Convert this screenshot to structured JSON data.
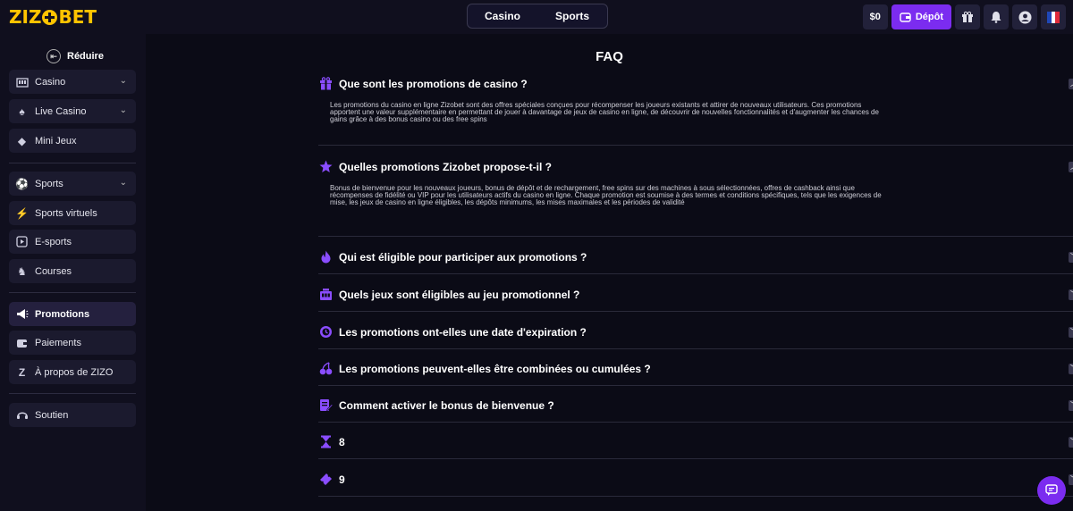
{
  "brand": {
    "part1": "ZIZ",
    "part2": "BET"
  },
  "topnav": [
    "Casino",
    "Sports"
  ],
  "header": {
    "balance": "$0",
    "deposit": "Dépôt"
  },
  "sidebar": {
    "reduce": "Réduire",
    "items": [
      {
        "label": "Casino",
        "icon": "slot-machine-icon",
        "chevron": true
      },
      {
        "label": "Live Casino",
        "icon": "live-casino-icon",
        "chevron": true
      },
      {
        "label": "Mini Jeux",
        "icon": "diamond-icon",
        "chevron": false
      },
      {
        "label": "Sports",
        "icon": "football-icon",
        "chevron": true
      },
      {
        "label": "Sports virtuels",
        "icon": "virtual-sports-icon",
        "chevron": false
      },
      {
        "label": "E-sports",
        "icon": "gamepad-icon",
        "chevron": false
      },
      {
        "label": "Courses",
        "icon": "horse-icon",
        "chevron": false
      },
      {
        "label": "Promotions",
        "icon": "megaphone-icon",
        "chevron": false
      },
      {
        "label": "Paiements",
        "icon": "wallet-icon",
        "chevron": false
      },
      {
        "label": "À propos de ZIZO",
        "icon": "zizo-z-icon",
        "chevron": false
      },
      {
        "label": "Soutien",
        "icon": "support-icon",
        "chevron": false
      }
    ]
  },
  "faq": {
    "title": "FAQ",
    "items": [
      {
        "q": "Que sont les promotions de casino ?",
        "icon": "gift-icon",
        "open": true,
        "a": "Les promotions du casino en ligne Zizobet sont des offres spéciales conçues pour récompenser les joueurs existants et attirer de nouveaux utilisateurs. Ces promotions apportent une valeur supplémentaire en permettant de jouer à davantage de jeux de casino en ligne, de découvrir de nouvelles fonctionnalités et d'augmenter les chances de gains grâce à des bonus casino ou des free spins"
      },
      {
        "q": "Quelles promotions Zizobet propose-t-il ?",
        "icon": "star-icon",
        "open": true,
        "a": "Bonus de bienvenue pour les nouveaux joueurs, bonus de dépôt et de rechargement, free spins sur des machines à sous sélectionnées, offres de cashback ainsi que récompenses de fidélité ou VIP pour les utilisateurs actifs du casino en ligne. Chaque promotion est soumise à des termes et conditions spécifiques, tels que les exigences de mise, les jeux de casino en ligne éligibles, les dépôts minimums, les mises maximales et les périodes de validité"
      },
      {
        "q": "Qui est éligible pour participer aux promotions ?",
        "icon": "fire-icon",
        "open": false,
        "a": ""
      },
      {
        "q": "Quels jeux sont éligibles au jeu promotionnel ?",
        "icon": "slot-machine-icon",
        "open": false,
        "a": ""
      },
      {
        "q": "Les promotions ont-elles une date d'expiration ?",
        "icon": "clock-icon",
        "open": false,
        "a": ""
      },
      {
        "q": "Les promotions peuvent-elles être combinées ou cumulées ?",
        "icon": "cherry-icon",
        "open": false,
        "a": ""
      },
      {
        "q": "Comment activer le bonus de bienvenue ?",
        "icon": "edit-document-icon",
        "open": false,
        "a": ""
      },
      {
        "q": "8",
        "icon": "hourglass-icon",
        "open": false,
        "a": ""
      },
      {
        "q": "9",
        "icon": "ticket-icon",
        "open": false,
        "a": ""
      }
    ]
  },
  "colors": {
    "accent": "#7b2cf0",
    "brand": "#ffc400",
    "background": "#0b0b16"
  }
}
